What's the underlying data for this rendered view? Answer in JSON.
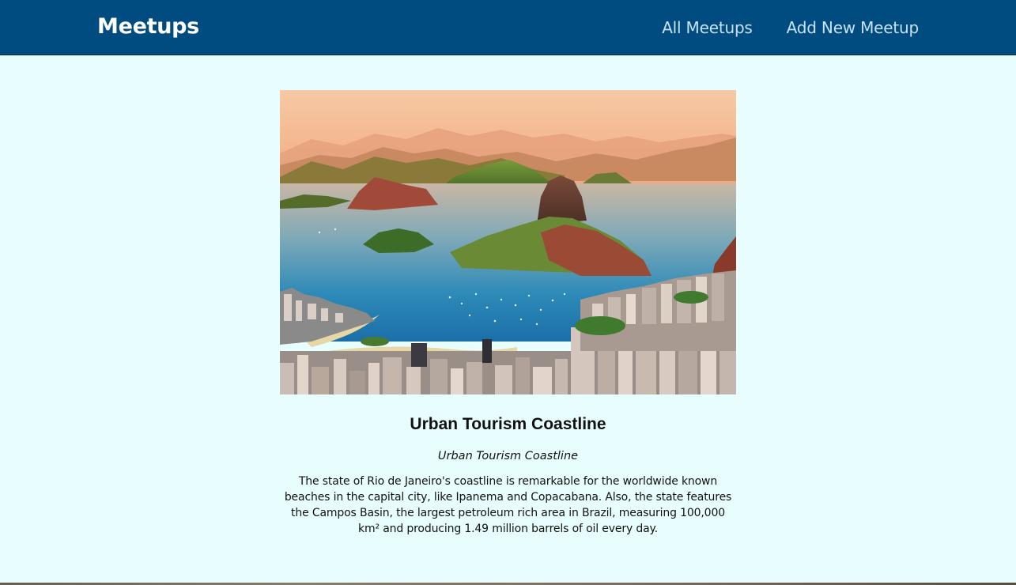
{
  "header": {
    "logo": "Meetups",
    "nav": [
      {
        "label": "All Meetups"
      },
      {
        "label": "Add New Meetup"
      }
    ],
    "background_color": "#004b7f",
    "nav_color": "#c8e2ff"
  },
  "meetup": {
    "image_alt": "Urban Tourism Coastline",
    "title": "Urban Tourism Coastline",
    "address": "Urban Tourism Coastline",
    "description": "The state of Rio de Janeiro's coastline is remarkable for the worldwide known beaches in the capital city, like Ipanema and Copacabana. Also, the state features the Campos Basin, the largest petroleum rich area in Brazil, measuring 100,000 km² and producing 1.49 million barrels of oil every day."
  },
  "page": {
    "background_color": "#e8fefe"
  }
}
